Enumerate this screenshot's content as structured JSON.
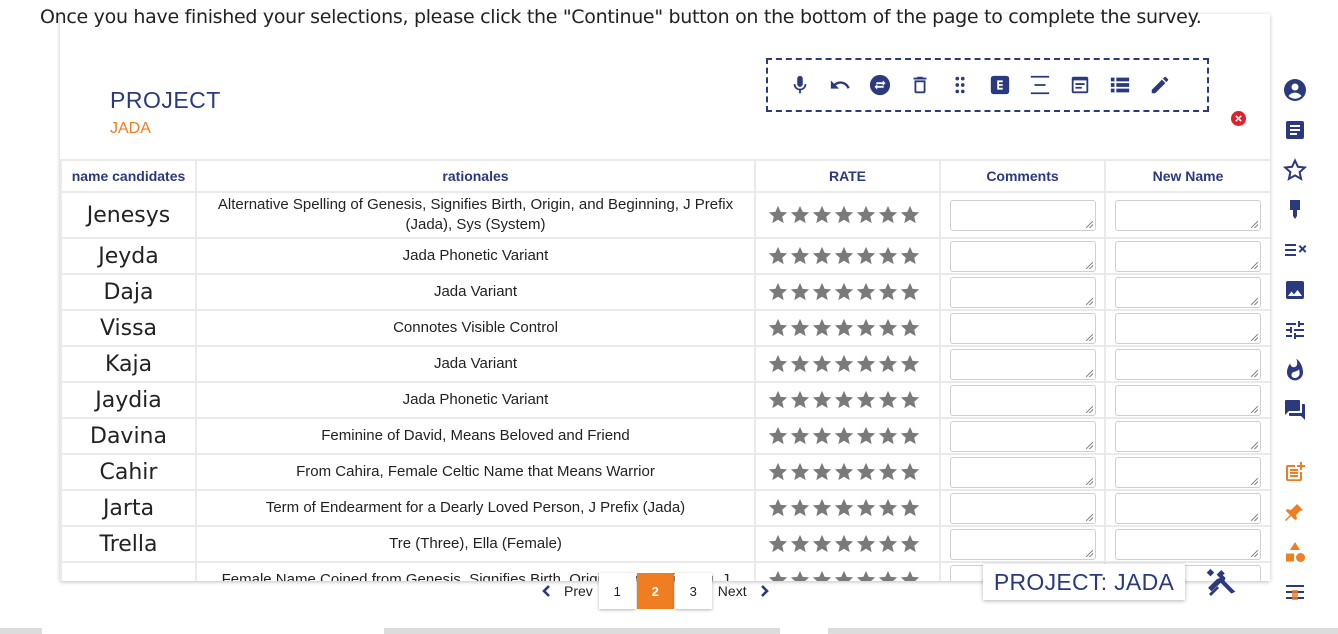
{
  "instructions": "Once you have finished your selections, please click the \"Continue\" button on the bottom of the page to complete the survey.",
  "project": {
    "title": "PROJECT",
    "subtitle": "JADA"
  },
  "toolbar_icons": [
    "microphone-icon",
    "undo-icon",
    "swap-icon",
    "trash-icon",
    "drag-handle-icon",
    "e-box-icon",
    "align-center-icon",
    "form-icon",
    "list-icon",
    "pencil-icon"
  ],
  "table": {
    "headers": [
      "name candidates",
      "rationales",
      "RATE",
      "Comments",
      "New Name"
    ],
    "stars_per_row": 7,
    "rows": [
      {
        "name": "Jenesys",
        "rationale": "Alternative Spelling of Genesis, Signifies Birth, Origin, and Beginning, J Prefix (Jada), Sys (System)"
      },
      {
        "name": "Jeyda",
        "rationale": "Jada Phonetic Variant"
      },
      {
        "name": "Daja",
        "rationale": "Jada Variant"
      },
      {
        "name": "Vissa",
        "rationale": "Connotes Visible Control"
      },
      {
        "name": "Kaja",
        "rationale": "Jada Variant"
      },
      {
        "name": "Jaydia",
        "rationale": "Jada Phonetic Variant"
      },
      {
        "name": "Davina",
        "rationale": "Feminine of David, Means Beloved and Friend"
      },
      {
        "name": "Cahir",
        "rationale": "From Cahira, Female Celtic Name that Means Warrior"
      },
      {
        "name": "Jarta",
        "rationale": "Term of Endearment for a Dearly Loved Person, J Prefix (Jada)"
      },
      {
        "name": "Trella",
        "rationale": "Tre (Three), Ella (Female)"
      },
      {
        "name": "",
        "rationale": "Female Name Coined from Genesis, Signifies Birth, Origin, and Beginning, J"
      }
    ]
  },
  "pagination": {
    "prev": "Prev",
    "next": "Next",
    "pages": [
      "1",
      "2",
      "3"
    ],
    "current": "2"
  },
  "badge": "PROJECT: JADA",
  "sidebar_icons": [
    "user-icon",
    "document-icon",
    "star-icon",
    "award-icon",
    "sort-icon",
    "image-icon",
    "sliders-icon",
    "flame-icon",
    "chat-icon",
    "add-note-icon",
    "pin-icon",
    "shapes-icon",
    "menu-icon"
  ],
  "colors": {
    "brand_navy": "#2b3a7e",
    "accent_orange": "#ef7d22",
    "close_red": "#e0202a",
    "star_gray": "#7a7a7a"
  }
}
